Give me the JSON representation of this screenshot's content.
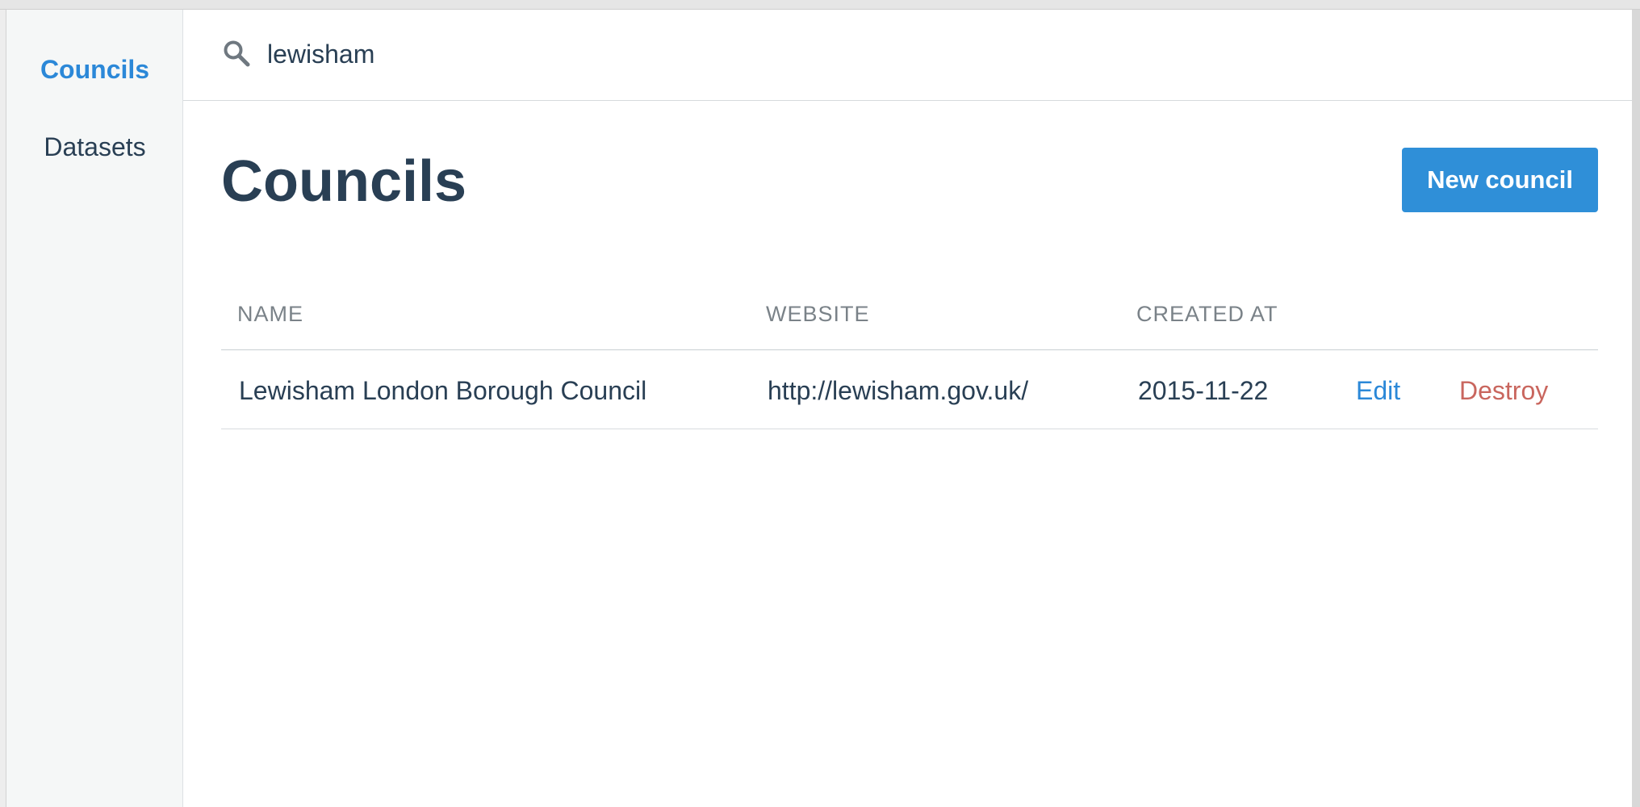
{
  "sidebar": {
    "items": [
      {
        "label": "Councils",
        "active": true
      },
      {
        "label": "Datasets",
        "active": false
      }
    ]
  },
  "search": {
    "value": "lewisham",
    "icon": "search-icon"
  },
  "page": {
    "title": "Councils",
    "new_button_label": "New council"
  },
  "table": {
    "headers": {
      "name": "NAME",
      "website": "WEBSITE",
      "created_at": "CREATED AT"
    },
    "rows": [
      {
        "name": "Lewisham London Borough Council",
        "website": "http://lewisham.gov.uk/",
        "created_at": "2015-11-22",
        "edit_label": "Edit",
        "destroy_label": "Destroy"
      }
    ]
  },
  "colors": {
    "accent": "#2f8fd8",
    "text": "#293f54",
    "danger": "#c9665e",
    "sidebar_bg": "#f5f7f7"
  }
}
